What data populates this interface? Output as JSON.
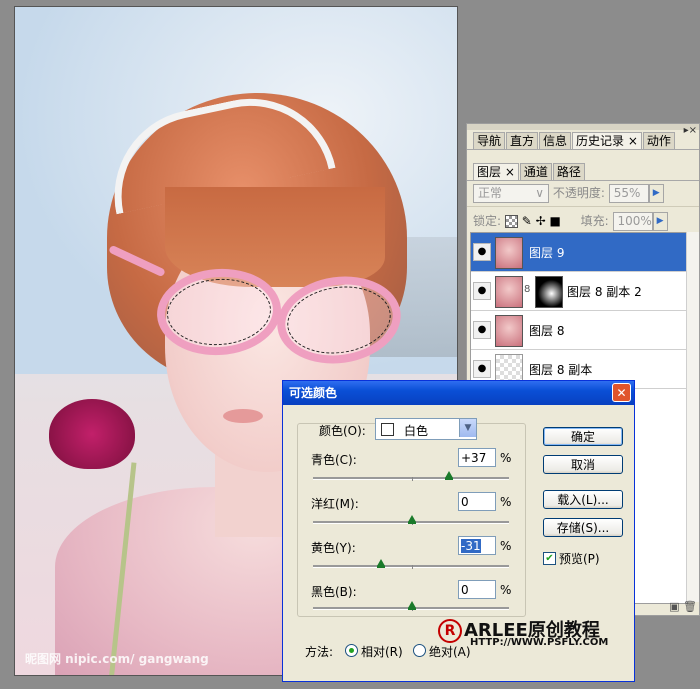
{
  "photo": {
    "watermark": "昵图网 nipic.com/ gangwang"
  },
  "panel": {
    "top_tabs": [
      {
        "label": "导航"
      },
      {
        "label": "直方"
      },
      {
        "label": "信息"
      },
      {
        "label": "历史记录 ×"
      },
      {
        "label": "动作"
      }
    ],
    "layer_tabs": [
      {
        "label": "图层 ×"
      },
      {
        "label": "通道"
      },
      {
        "label": "路径"
      }
    ],
    "blend_mode": "正常",
    "opacity_label": "不透明度:",
    "opacity_value": "55%",
    "lock_label": "锁定:",
    "fill_label": "填充:",
    "fill_value": "100%",
    "layers": [
      {
        "name": "图层 9",
        "selected": true
      },
      {
        "name": "图层 8 副本 2"
      },
      {
        "name": "图层 8"
      },
      {
        "name": "图层 8 副本"
      }
    ]
  },
  "dialog": {
    "title": "可选颜色",
    "color_label": "颜色(O):",
    "color_value": "白色",
    "cyan_label": "青色(C):",
    "cyan_value": "+37",
    "magenta_label": "洋红(M):",
    "magenta_value": "0",
    "yellow_label": "黄色(Y):",
    "yellow_value": "-31",
    "black_label": "黑色(B):",
    "black_value": "0",
    "percent": "%",
    "ok": "确定",
    "cancel": "取消",
    "load": "载入(L)...",
    "save": "存储(S)...",
    "preview": "预览(P)",
    "method_label": "方法:",
    "relative": "相对(R)",
    "absolute": "绝对(A)"
  },
  "brand": {
    "name": "ARLEE原创教程",
    "url": "HTTP://WWW.PSFLY.COM"
  }
}
